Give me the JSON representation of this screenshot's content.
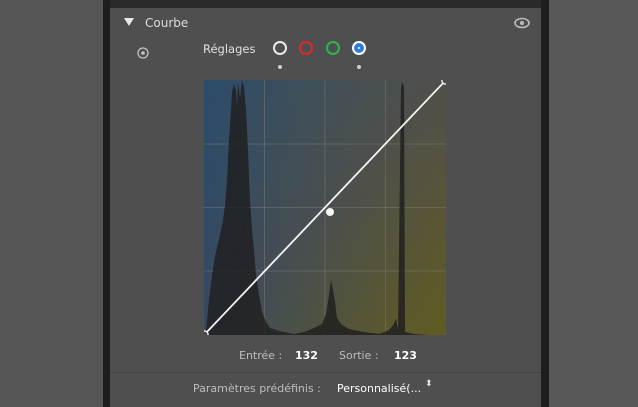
{
  "panel": {
    "title": "Courbe",
    "settings_label": "Réglages",
    "channels": [
      {
        "name": "luminance",
        "color": "#eaeaea"
      },
      {
        "name": "red",
        "color": "#e1262c"
      },
      {
        "name": "green",
        "color": "#2cb84a"
      },
      {
        "name": "blue",
        "color": "#2f7fe0",
        "active": true
      }
    ],
    "icons": {
      "collapse": "triangle-down-icon",
      "visibility": "eye-icon",
      "target_adjust": "target-icon"
    }
  },
  "curve": {
    "input_label": "Entrée :",
    "input_value": "132",
    "output_label": "Sortie :",
    "output_value": "123"
  },
  "presets": {
    "label": "Paramètres prédéfinis :",
    "value": "Personnalisé(... ",
    "arrows": "⬍"
  }
}
